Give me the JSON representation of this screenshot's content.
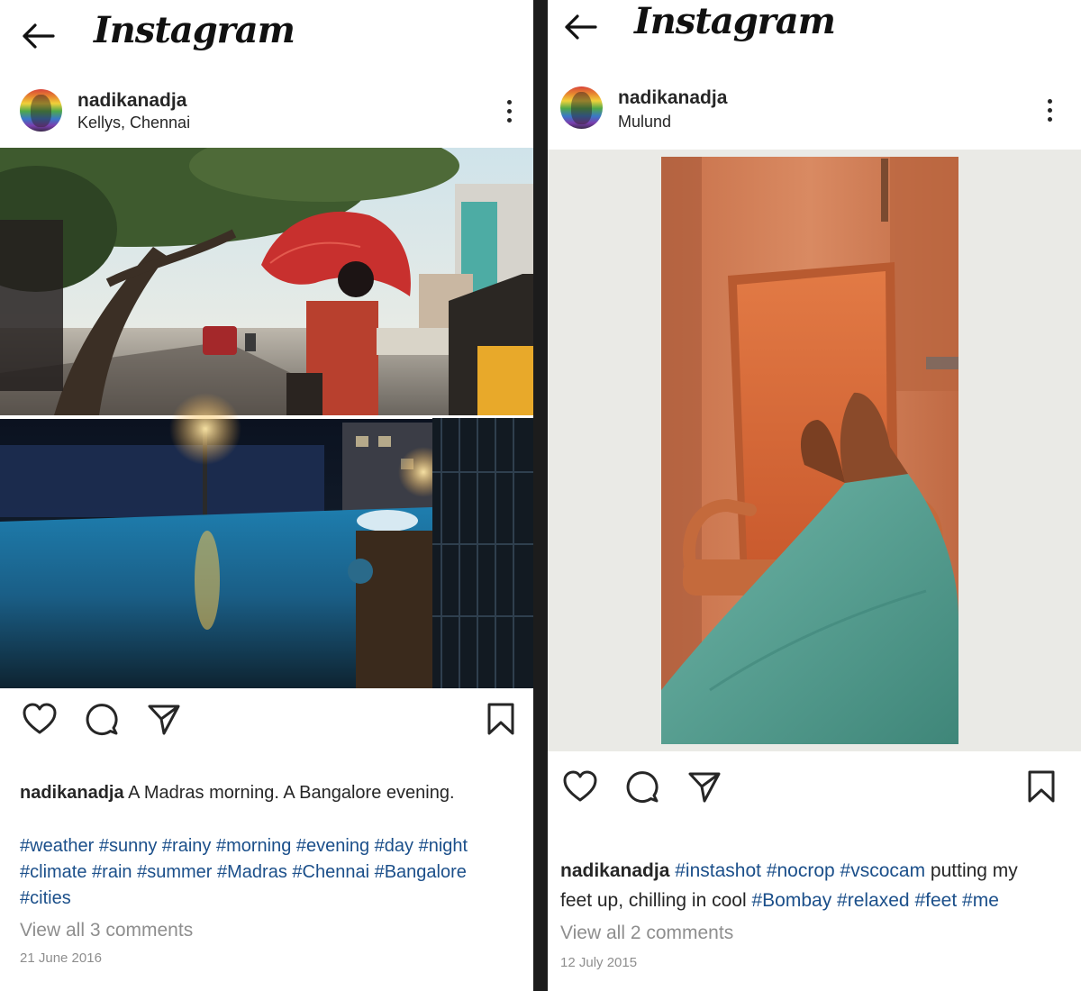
{
  "left": {
    "brand": "Instagram",
    "post": {
      "username": "nadikanadja",
      "location": "Kellys, Chennai",
      "caption_user": "nadikanadja",
      "caption_text": "A Madras morning. A Bangalore evening.",
      "hashtags": [
        "#weather",
        "#sunny",
        "#rainy",
        "#morning",
        "#evening",
        "#day",
        "#night",
        "#climate",
        "#rain",
        "#summer",
        "#Madras",
        "#Chennai",
        "#Bangalore",
        "#cities"
      ],
      "comments_link": "View all 3 comments",
      "date": "21 June 2016"
    },
    "icons": {
      "back": "arrow-left-icon",
      "more": "more-vertical-icon",
      "like": "heart-icon",
      "comment": "comment-icon",
      "share": "send-icon",
      "save": "bookmark-icon"
    }
  },
  "right": {
    "brand": "Instagram",
    "post": {
      "username": "nadikanadja",
      "location": "Mulund",
      "caption_user": "nadikanadja",
      "caption_line1_tags": [
        "#instashot",
        "#nocrop",
        "#vscocam"
      ],
      "caption_line1_text": "putting my",
      "caption_line2_text": "feet up, chilling in cool",
      "caption_line2_tags": [
        "#Bombay",
        "#relaxed",
        "#feet",
        "#me"
      ],
      "comments_link": "View all 2 comments",
      "date": "12 July 2015"
    }
  },
  "colors": {
    "hashtag": "#1b4f8a",
    "muted": "#8e8e8e",
    "text": "#262626",
    "divider": "#1c1c1c",
    "photo_backdrop": "#eaeae6"
  }
}
